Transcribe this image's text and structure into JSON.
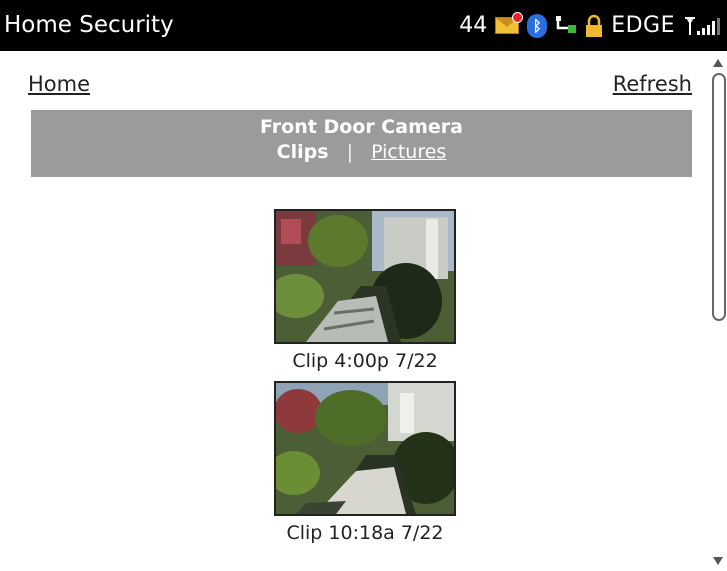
{
  "status_bar": {
    "app_title": "Home Security",
    "message_count": "44",
    "network": "EDGE",
    "icons": [
      "envelope-icon",
      "bluetooth-icon",
      "connection-icon",
      "lock-icon",
      "signal-icon"
    ]
  },
  "nav": {
    "home": "Home",
    "refresh": "Refresh"
  },
  "banner": {
    "title": "Front Door Camera",
    "clips": "Clips",
    "separator": "|",
    "pictures": "Pictures"
  },
  "clips": [
    {
      "label": "Clip 4:00p 7/22"
    },
    {
      "label": "Clip 10:18a 7/22"
    }
  ],
  "colors": {
    "status_bg": "#000000",
    "banner_bg": "#9b9b9b",
    "link": "#222222"
  }
}
